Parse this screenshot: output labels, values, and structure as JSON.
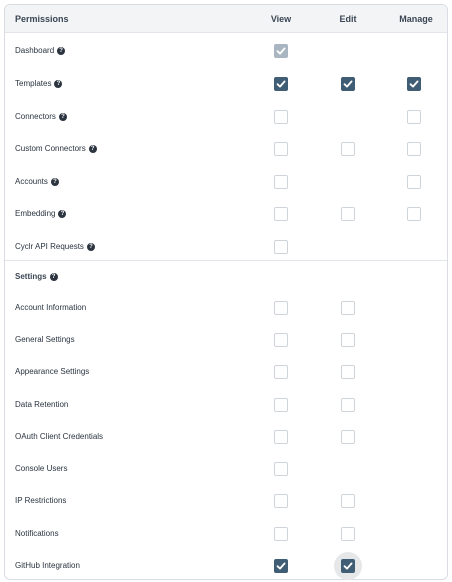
{
  "header": {
    "permissions_label": "Permissions",
    "view_label": "View",
    "edit_label": "Edit",
    "manage_label": "Manage"
  },
  "rows": [
    {
      "label": "Dashboard",
      "help": true,
      "view": "checked-disabled",
      "edit": null,
      "manage": null
    },
    {
      "label": "Templates",
      "help": true,
      "view": "checked",
      "edit": "checked",
      "manage": "checked"
    },
    {
      "label": "Connectors",
      "help": true,
      "view": "unchecked",
      "edit": null,
      "manage": "unchecked"
    },
    {
      "label": "Custom Connectors",
      "help": true,
      "view": "unchecked",
      "edit": "unchecked",
      "manage": "unchecked"
    },
    {
      "label": "Accounts",
      "help": true,
      "view": "unchecked",
      "edit": null,
      "manage": "unchecked"
    },
    {
      "label": "Embedding",
      "help": true,
      "view": "unchecked",
      "edit": "unchecked",
      "manage": "unchecked"
    },
    {
      "label": "Cyclr API Requests",
      "help": true,
      "view": "unchecked",
      "edit": null,
      "manage": null
    }
  ],
  "settings_section": {
    "label": "Settings",
    "help": true
  },
  "settings_rows": [
    {
      "label": "Account Information",
      "view": "unchecked",
      "edit": "unchecked"
    },
    {
      "label": "General Settings",
      "view": "unchecked",
      "edit": "unchecked"
    },
    {
      "label": "Appearance Settings",
      "view": "unchecked",
      "edit": "unchecked"
    },
    {
      "label": "Data Retention",
      "view": "unchecked",
      "edit": "unchecked"
    },
    {
      "label": "OAuth Client Credentials",
      "view": "unchecked",
      "edit": "unchecked"
    },
    {
      "label": "Console Users",
      "view": "unchecked",
      "edit": null
    },
    {
      "label": "IP Restrictions",
      "view": "unchecked",
      "edit": "unchecked"
    },
    {
      "label": "Notifications",
      "view": "unchecked",
      "edit": "unchecked"
    },
    {
      "label": "GitHub Integration",
      "view": "checked",
      "edit": "checked-focused"
    }
  ],
  "colors": {
    "checked": "#3f5d75",
    "checked_disabled": "#a9b6c1",
    "border": "#cfd4da"
  },
  "help_icon": "question-circle-icon",
  "check_icon": "checkmark-icon"
}
